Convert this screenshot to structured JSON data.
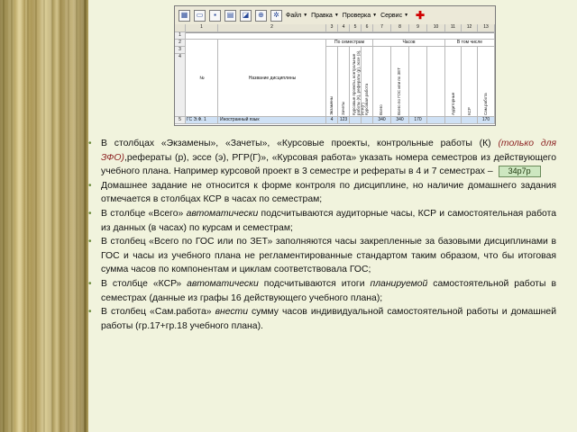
{
  "toolbar": {
    "menu": [
      "Файл",
      "Правка",
      "Проверка",
      "Сервис"
    ]
  },
  "sheet": {
    "col_numbers": [
      "1",
      "2",
      "3",
      "4",
      "5",
      "6",
      "7",
      "8",
      "9",
      "10",
      "11",
      "12",
      "13"
    ],
    "row_numbers": [
      "1",
      "2",
      "3",
      "4",
      "5",
      "6"
    ],
    "header_no": "№",
    "header_name": "Название дисциплины",
    "group_control": "По семестрам",
    "group_hours": "Часов",
    "group_total": "В том числе",
    "vertical_headers": [
      "Экзамены",
      "Зачеты",
      "Курсовые проекты, контрольные работы (К), рефераты (р), эссе (э), РГР(Г)",
      "Курсовая работа",
      "Всего",
      "Всего по ГОС или по ЗЕТ",
      "Аудиторные",
      "КСР",
      "Сам.работа"
    ],
    "row6": {
      "code": "ГС Э.Ф. 1",
      "name": "Иностранный язык",
      "exam": "4",
      "credit": "123",
      "total": "340",
      "gos": "340",
      "aud": "170",
      "sam": "170"
    }
  },
  "bullets": {
    "b1_part1": "В столбцах «Экзамены», «Зачеты», «Курсовые проекты, контрольные работы (К) ",
    "b1_part2": "(только для ЗФО)",
    "b1_part3": ",рефераты (р), эссе (э), РГР(Г)», «Курсовая работа» указать номера семестров из действующего учебного плана. Например курсовой проект в 3 семестре и рефераты в 4 и 7 семестрах –",
    "b1_tag": "34р7р",
    "b2": "Домашнее задание не относится к форме контроля по дисциплине, но наличие домашнего задания отмечается в столбцах КСР в часах по семестрам;",
    "b3_part1": "В столбце «Всего» ",
    "b3_part2": "автоматически",
    "b3_part3": " подсчитываются аудиторные часы, КСР и самостоятельная работа из данных (в часах) по курсам и семестрам;",
    "b4": "В столбец «Всего по ГОС или по ЗЕТ» заполняются часы закрепленные за базовыми дисциплинами в ГОС и часы из учебного плана не регламентированные стандартом таким образом, что бы итоговая сумма часов  по компонентам и циклам соответствовала ГОС;",
    "b5_part1": "В столбце «КСР» ",
    "b5_part2": "автоматически",
    "b5_part3": " подсчитываются итоги ",
    "b5_part4": "планируемой",
    "b5_part5": " самостоятельной работы в семестрах (данные из графы 16 действующего учебного плана);",
    "b6_part1": "В столбец «Сам.работа» ",
    "b6_part2": "внести",
    "b6_part3": " сумму часов индивидуальной самостоятельной работы и домашней работы (гр.17+гр.18 учебного плана)."
  }
}
